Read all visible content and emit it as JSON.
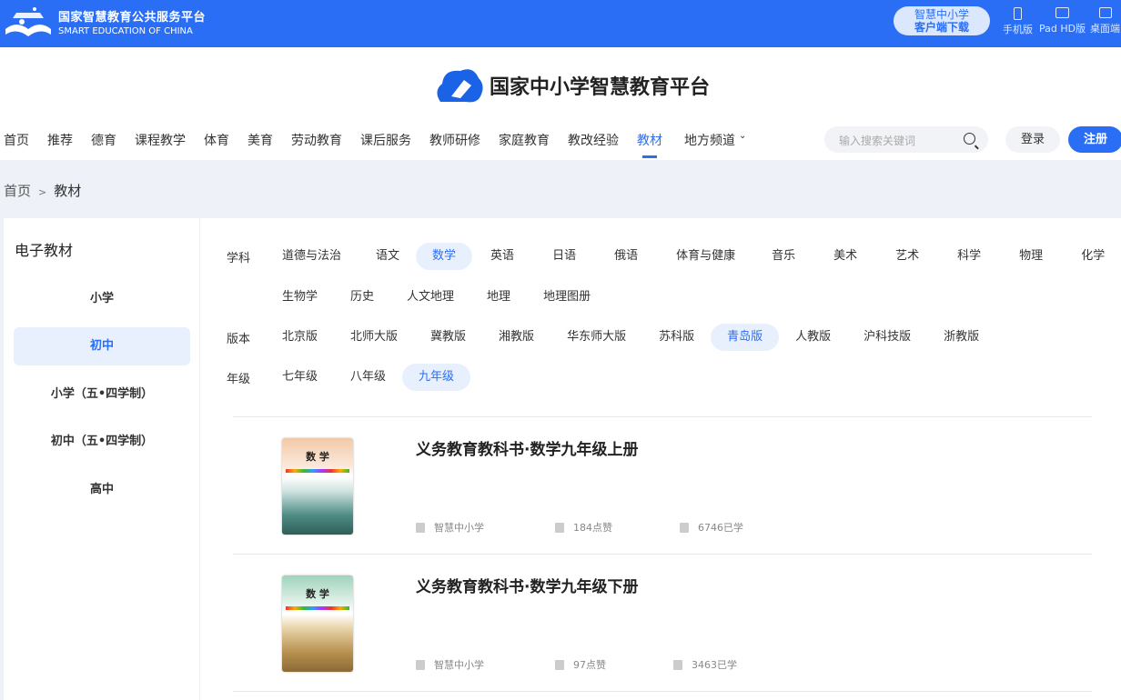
{
  "topbar": {
    "brand_cn": "国家智慧教育公共服务平台",
    "brand_en": "SMART EDUCATION OF CHINA",
    "download_line1": "智慧中小学",
    "download_line2": "客户端下载",
    "devices": [
      "手机版",
      "Pad HD版",
      "桌面端"
    ]
  },
  "header": {
    "logo_text": "国家中小学智慧教育平台",
    "nav": [
      "首页",
      "推荐",
      "德育",
      "课程教学",
      "体育",
      "美育",
      "劳动教育",
      "课后服务",
      "教师研修",
      "家庭教育",
      "教改经验",
      "教材",
      "地方频道"
    ],
    "search_placeholder": "输入搜索关键词",
    "login": "登录",
    "register": "注册"
  },
  "breadcrumb": {
    "home": "首页",
    "sep": ">",
    "current": "教材"
  },
  "sidebar": {
    "title": "电子教材",
    "items": [
      "小学",
      "初中",
      "小学（五•四学制）",
      "初中（五•四学制）",
      "高中"
    ]
  },
  "filters": {
    "subject_label": "学科",
    "subjects_row1": [
      "道德与法治",
      "语文",
      "数学",
      "英语",
      "日语",
      "俄语",
      "体育与健康",
      "音乐",
      "美术",
      "艺术",
      "科学",
      "物理",
      "化学"
    ],
    "subjects_row2": [
      "生物学",
      "历史",
      "人文地理",
      "地理",
      "地理图册"
    ],
    "edition_label": "版本",
    "editions": [
      "北京版",
      "北师大版",
      "冀教版",
      "湘教版",
      "华东师大版",
      "苏科版",
      "青岛版",
      "人教版",
      "沪科技版",
      "浙教版"
    ],
    "grade_label": "年级",
    "grades": [
      "七年级",
      "八年级",
      "九年级"
    ]
  },
  "books": [
    {
      "title": "义务教育教科书·数学九年级上册",
      "cover_title": "数 学",
      "source": "智慧中小学",
      "likes": "184点赞",
      "learners": "6746已学"
    },
    {
      "title": "义务教育教科书·数学九年级下册",
      "cover_title": "数 学",
      "source": "智慧中小学",
      "likes": "97点赞",
      "learners": "3463已学"
    }
  ]
}
